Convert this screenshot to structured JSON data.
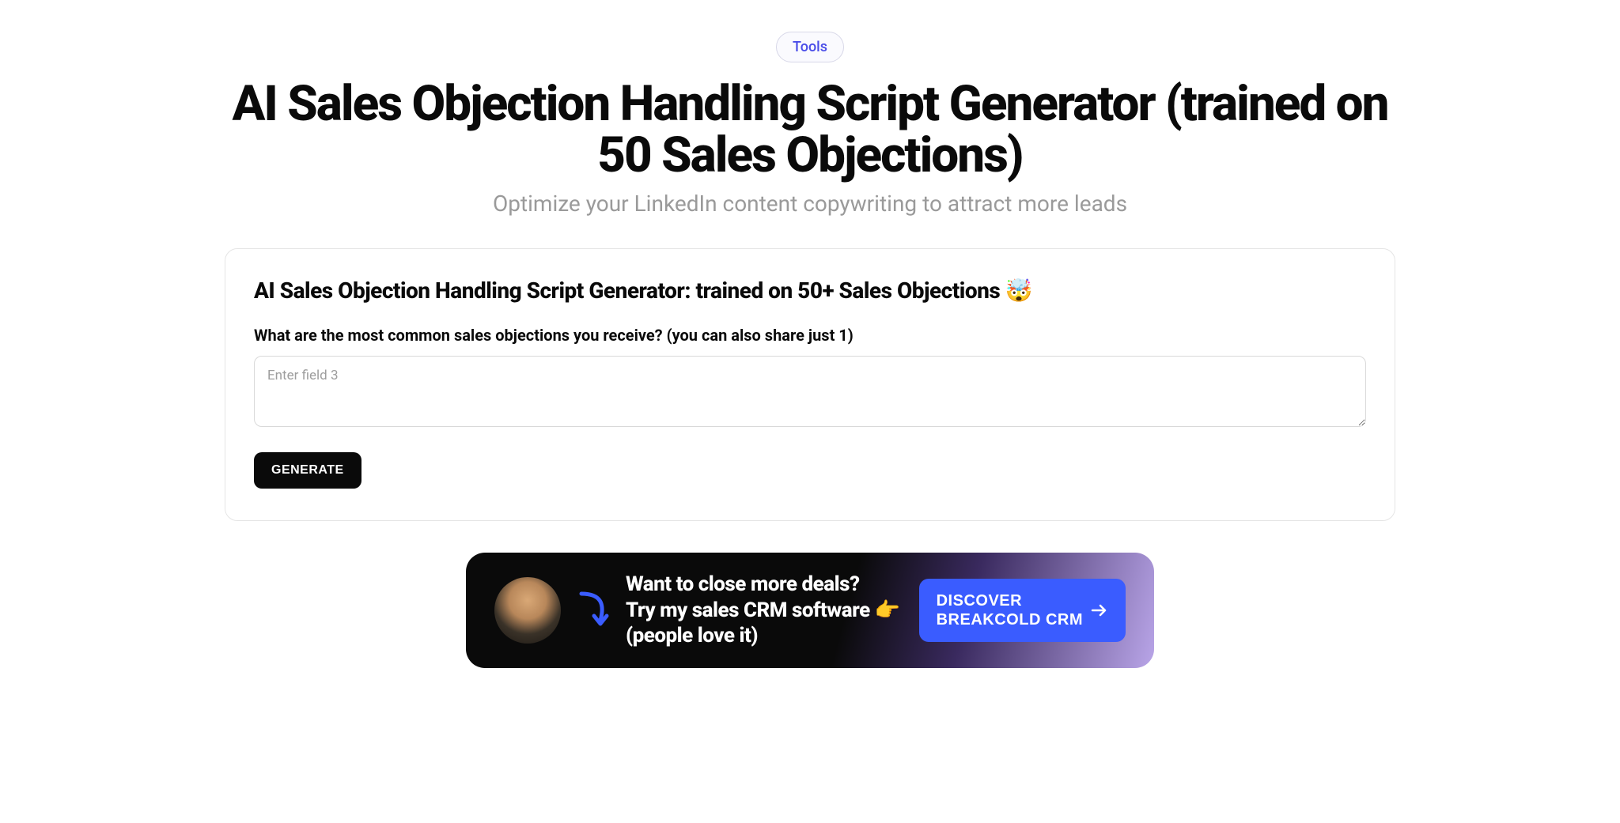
{
  "header": {
    "badge": "Tools",
    "title": "AI Sales Objection Handling Script Generator (trained on 50 Sales Objections)",
    "subtitle": "Optimize your LinkedIn content copywriting to attract more leads"
  },
  "card": {
    "title": "AI Sales Objection Handling Script Generator: trained on 50+ Sales Objections 🤯",
    "field_label": "What are the most common sales objections you receive? (you can also share just 1)",
    "placeholder": "Enter field 3",
    "generate_label": "GENERATE"
  },
  "promo": {
    "line1": "Want to close more deals?",
    "line2": "Try my sales CRM software 👉",
    "line3": "(people love it)",
    "cta_line1": "DISCOVER",
    "cta_line2": "BREAKCOLD CRM"
  }
}
